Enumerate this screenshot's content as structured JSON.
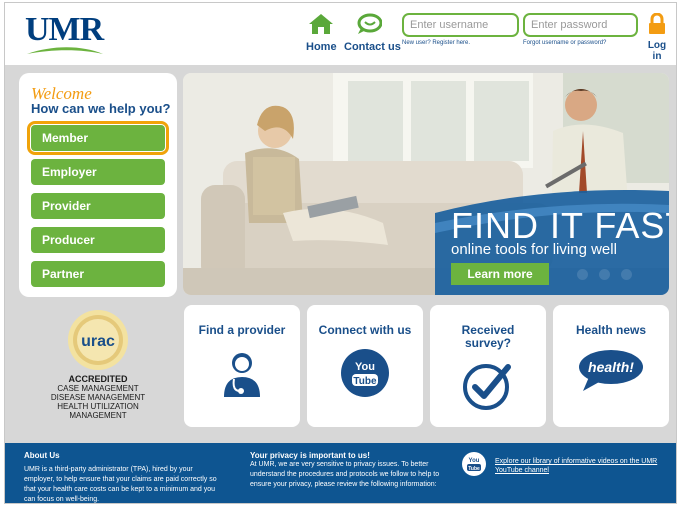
{
  "header": {
    "logo_text": "UMR",
    "nav": {
      "home_label": "Home",
      "contact_label": "Contact us"
    },
    "login": {
      "username_placeholder": "Enter username",
      "password_placeholder": "Enter password",
      "register_link": "New user? Register here.",
      "forgot_link": "Forgot username or password?",
      "login_label": "Log in"
    }
  },
  "welcome": {
    "title": "Welcome",
    "subtitle": "How can we help you?",
    "roles": [
      "Member",
      "Employer",
      "Provider",
      "Producer",
      "Partner"
    ],
    "active_role": "Member"
  },
  "hero": {
    "headline": "FIND IT FAST",
    "subline": "online tools for living well",
    "cta_label": "Learn more"
  },
  "accreditation": {
    "seal_text": "urac",
    "heading": "ACCREDITED",
    "lines": [
      "CASE MANAGEMENT",
      "DISEASE MANAGEMENT",
      "HEALTH UTILIZATION",
      "MANAGEMENT"
    ]
  },
  "tiles": [
    {
      "title": "Find a provider",
      "icon": "doctor-icon"
    },
    {
      "title": "Connect with us",
      "icon": "youtube-icon",
      "icon_text_1": "You",
      "icon_text_2": "Tube"
    },
    {
      "title": "Received survey?",
      "icon": "checkmark-icon"
    },
    {
      "title": "Health news",
      "icon": "health-bubble-icon",
      "icon_text": "health!"
    }
  ],
  "footer": {
    "about_heading": "About Us",
    "about_text": "UMR is a third-party administrator (TPA), hired by your employer, to help ensure that your claims are paid correctly so that your health care costs can be kept to a minimum and you can focus on well-being.",
    "privacy_heading": "Your privacy is important to us!",
    "privacy_text": "At UMR, we are very sensitive to privacy issues. To better understand the procedures and protocols we follow to help to ensure your privacy, please review the following information:",
    "youtube_badge_1": "You",
    "youtube_badge_2": "Tube",
    "youtube_link": "Explore our library of informative videos on the UMR YouTube channel"
  },
  "colors": {
    "brand_blue": "#003e7e",
    "link_blue": "#1a4f8a",
    "accent_green": "#6cb33f",
    "welcome_orange": "#f39c12",
    "footer_blue": "#0e5591",
    "panel_gray": "#d7d7d7"
  }
}
